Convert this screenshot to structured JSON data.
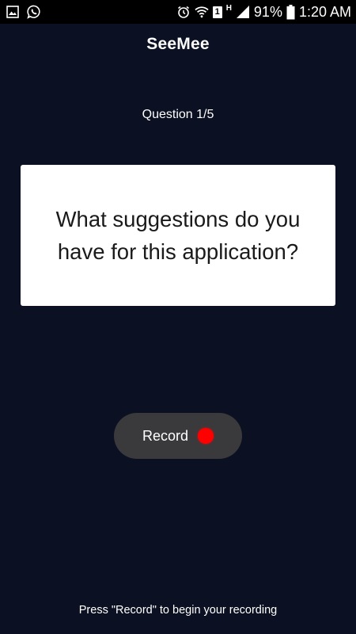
{
  "status_bar": {
    "battery_percent": "91%",
    "time": "1:20 AM",
    "sim_slot": "1",
    "network_type": "H",
    "icons": [
      "gallery-icon",
      "whatsapp-icon",
      "alarm-icon",
      "wifi-icon",
      "sim-icon",
      "signal-icon",
      "battery-icon"
    ]
  },
  "app": {
    "title": "SeeMee"
  },
  "question": {
    "counter": "Question 1/5",
    "text": "What suggestions do you have for this application?"
  },
  "record": {
    "label": "Record",
    "dot_color": "#ff0000"
  },
  "instruction": "Press \"Record\" to begin your recording",
  "colors": {
    "background": "#0b1122",
    "card": "#ffffff",
    "button": "#3a3a3c",
    "record_dot": "#ff0000"
  }
}
